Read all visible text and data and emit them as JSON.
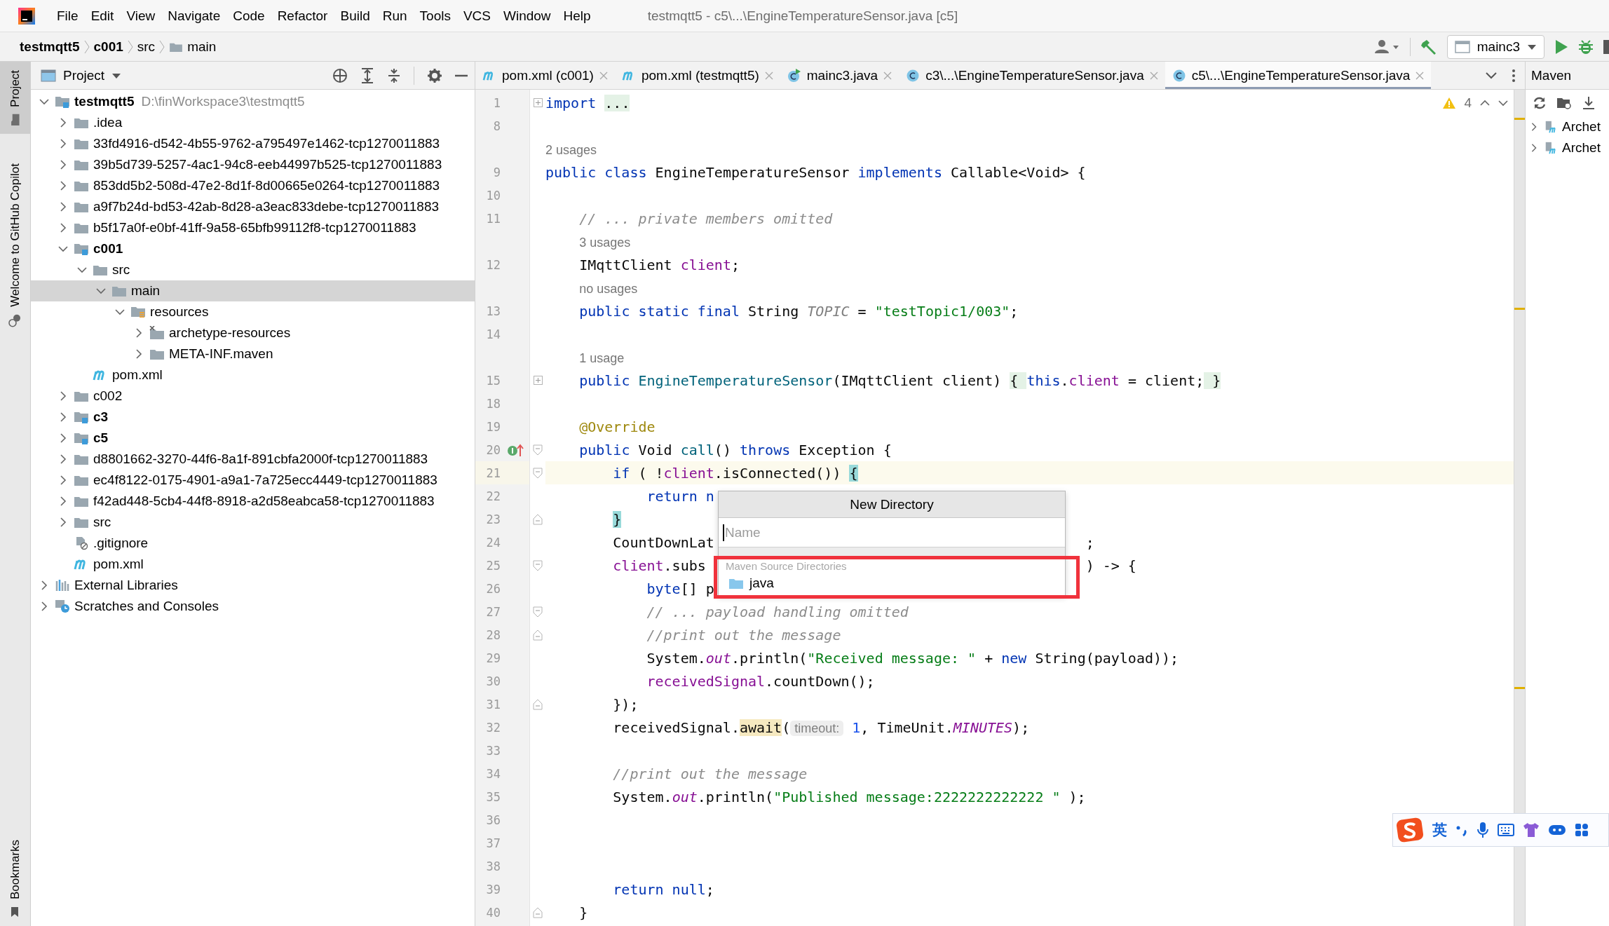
{
  "title_bar": {
    "menu": [
      "File",
      "Edit",
      "View",
      "Navigate",
      "Code",
      "Refactor",
      "Build",
      "Run",
      "Tools",
      "VCS",
      "Window",
      "Help"
    ],
    "title": "testmqtt5 - c5\\...\\EngineTemperatureSensor.java [c5]"
  },
  "breadcrumbs": [
    {
      "label": "testmqtt5",
      "kind": "module"
    },
    {
      "label": "c001",
      "kind": "module"
    },
    {
      "label": "src",
      "kind": "dir"
    },
    {
      "label": "main",
      "kind": "folder"
    }
  ],
  "toolbar": {
    "run_config": "mainc3"
  },
  "side_tabs": [
    {
      "label": "Project",
      "selected": true
    },
    {
      "label": "Welcome to GitHub Copilot",
      "selected": false
    }
  ],
  "side_tabs_bottom": [
    {
      "label": "Bookmarks",
      "selected": false
    }
  ],
  "project": {
    "title": "Project",
    "tree": [
      {
        "label": "testmqtt5",
        "kind": "module",
        "path": "D:\\finWorkspace3\\testmqtt5",
        "expanded": true,
        "selected": false,
        "children": [
          {
            "label": ".idea",
            "kind": "folder",
            "expanded": false,
            "selected": false
          },
          {
            "label": "33fd4916-d542-4b55-9762-a795497e1462-tcp1270011883",
            "kind": "folder",
            "expanded": false,
            "selected": false
          },
          {
            "label": "39b5d739-5257-4ac1-94c8-eeb44997b525-tcp1270011883",
            "kind": "folder",
            "expanded": false,
            "selected": false
          },
          {
            "label": "853dd5b2-508d-47e2-8d1f-8d00665e0264-tcp1270011883",
            "kind": "folder",
            "expanded": false,
            "selected": false
          },
          {
            "label": "a9f7b24d-bd53-42ab-8d28-a3eac833debe-tcp1270011883",
            "kind": "folder",
            "expanded": false,
            "selected": false
          },
          {
            "label": "b5f17a0f-e0bf-41ff-9a58-65bfb99112f8-tcp1270011883",
            "kind": "folder",
            "expanded": false,
            "selected": false
          },
          {
            "label": "c001",
            "kind": "module",
            "expanded": true,
            "selected": false,
            "children": [
              {
                "label": "src",
                "kind": "folder",
                "expanded": true,
                "selected": false,
                "children": [
                  {
                    "label": "main",
                    "kind": "folder",
                    "expanded": true,
                    "selected": true,
                    "children": [
                      {
                        "label": "resources",
                        "kind": "resources",
                        "expanded": true,
                        "selected": false,
                        "children": [
                          {
                            "label": "archetype-resources",
                            "kind": "excluded",
                            "expanded": false,
                            "selected": false
                          },
                          {
                            "label": "META-INF.maven",
                            "kind": "folder",
                            "expanded": false,
                            "selected": false
                          }
                        ]
                      }
                    ]
                  }
                ]
              },
              {
                "label": "pom.xml",
                "kind": "maven",
                "selected": false
              }
            ]
          },
          {
            "label": "c002",
            "kind": "folder",
            "expanded": false,
            "selected": false
          },
          {
            "label": "c3",
            "kind": "module",
            "expanded": false,
            "selected": false
          },
          {
            "label": "c5",
            "kind": "module",
            "expanded": false,
            "selected": false
          },
          {
            "label": "d8801662-3270-44f6-8a1f-891cbfa2000f-tcp1270011883",
            "kind": "folder",
            "expanded": false,
            "selected": false
          },
          {
            "label": "ec4f8122-0175-4901-a9a1-7a725ecc4449-tcp1270011883",
            "kind": "folder",
            "expanded": false,
            "selected": false
          },
          {
            "label": "f42ad448-5cb4-44f8-8918-a2d58eabca58-tcp1270011883",
            "kind": "folder",
            "expanded": false,
            "selected": false
          },
          {
            "label": "src",
            "kind": "folder",
            "expanded": false,
            "selected": false
          },
          {
            "label": ".gitignore",
            "kind": "ignored",
            "selected": false
          },
          {
            "label": "pom.xml",
            "kind": "maven",
            "selected": false
          }
        ]
      },
      {
        "label": "External Libraries",
        "kind": "libraries",
        "expanded": false,
        "selected": false
      },
      {
        "label": "Scratches and Consoles",
        "kind": "scratches",
        "expanded": false,
        "selected": false
      }
    ]
  },
  "editor": {
    "tabs": [
      {
        "label": "pom.xml (c001)",
        "kind": "maven",
        "selected": false
      },
      {
        "label": "pom.xml (testmqtt5)",
        "kind": "maven",
        "selected": false
      },
      {
        "label": "mainc3.java",
        "kind": "runnable",
        "selected": false
      },
      {
        "label": "c3\\...\\EngineTemperatureSensor.java",
        "kind": "class",
        "selected": false
      },
      {
        "label": "c5\\...\\EngineTemperatureSensor.java",
        "kind": "class",
        "selected": true
      }
    ],
    "warnings": "4",
    "lines": [
      {
        "number": "1",
        "current": false,
        "fold": {
          "kind": "collapsed"
        },
        "tokens": [
          {
            "text": "import ",
            "kind": "keyword"
          },
          {
            "text": "...",
            "kind": "folded"
          }
        ]
      },
      {
        "number": "8",
        "current": false
      },
      {
        "tokens": [
          {
            "text": "2 usages",
            "kind": "hint"
          }
        ]
      },
      {
        "number": "9",
        "current": false,
        "tokens": [
          {
            "text": "public class ",
            "kind": "keyword"
          },
          {
            "text": "EngineTemperatureSensor "
          },
          {
            "text": "implements ",
            "kind": "keyword"
          },
          {
            "text": "Callable<Void> {"
          }
        ]
      },
      {
        "number": "10",
        "current": false
      },
      {
        "number": "11",
        "current": false,
        "tokens": [
          {
            "text": "    // ... private members omitted",
            "kind": "comment"
          }
        ]
      },
      {
        "tokens": [
          {
            "text": "    3 usages",
            "kind": "hint"
          }
        ]
      },
      {
        "number": "12",
        "current": false,
        "tokens": [
          {
            "text": "    IMqttClient "
          },
          {
            "text": "client",
            "kind": "field"
          },
          {
            "text": ";"
          }
        ]
      },
      {
        "tokens": [
          {
            "text": "    no usages",
            "kind": "hint"
          }
        ]
      },
      {
        "number": "13",
        "current": false,
        "tokens": [
          {
            "text": "    public static final ",
            "kind": "keyword"
          },
          {
            "text": "String "
          },
          {
            "text": "TOPIC",
            "kind": "constant"
          },
          {
            "text": " = "
          },
          {
            "text": "\"testTopic1/003\"",
            "kind": "string"
          },
          {
            "text": ";"
          }
        ]
      },
      {
        "number": "14",
        "current": false
      },
      {
        "tokens": [
          {
            "text": "    1 usage",
            "kind": "hint"
          }
        ]
      },
      {
        "number": "15",
        "current": false,
        "fold": {
          "kind": "collapsed"
        },
        "tokens": [
          {
            "text": "    public ",
            "kind": "keyword"
          },
          {
            "text": "EngineTemperatureSensor",
            "kind": "method"
          },
          {
            "text": "(IMqttClient client) "
          },
          {
            "text": "{ ",
            "kind": "folded"
          },
          {
            "text": "this",
            "kind": "keyword"
          },
          {
            "text": "."
          },
          {
            "text": "client",
            "kind": "field"
          },
          {
            "text": " = client;"
          },
          {
            "text": " }",
            "kind": "folded"
          }
        ]
      },
      {
        "number": "18",
        "current": false
      },
      {
        "number": "19",
        "current": false,
        "tokens": [
          {
            "text": "    @Override",
            "kind": "annotation"
          }
        ]
      },
      {
        "number": "20",
        "current": false,
        "fold": {
          "kind": "start"
        },
        "marker": {
          "kind": "implements"
        },
        "tokens": [
          {
            "text": "    public ",
            "kind": "keyword"
          },
          {
            "text": "Void "
          },
          {
            "text": "call",
            "kind": "method"
          },
          {
            "text": "() "
          },
          {
            "text": "throws ",
            "kind": "keyword"
          },
          {
            "text": "Exception {"
          }
        ]
      },
      {
        "number": "21",
        "current": true,
        "fold": {
          "kind": "start"
        },
        "tokens": [
          {
            "text": "        if ",
            "kind": "keyword"
          },
          {
            "text": "( !"
          },
          {
            "text": "client",
            "kind": "field"
          },
          {
            "text": ".isConnected()) "
          },
          {
            "text": "{",
            "kind": "brace"
          }
        ]
      },
      {
        "number": "22",
        "current": false,
        "tokens": [
          {
            "text": "            return n",
            "kind": "keyword"
          }
        ]
      },
      {
        "number": "23",
        "current": false,
        "fold": {
          "kind": "end"
        },
        "tokens": [
          {
            "text": "        }",
            "kind": "brace"
          }
        ]
      },
      {
        "number": "24",
        "current": false,
        "tokens": [
          {
            "text": "        CountDownLat"
          }
        ],
        "tokens_after": [
          {
            "text": ";"
          }
        ]
      },
      {
        "number": "25",
        "current": false,
        "fold": {
          "kind": "start"
        },
        "tokens": [
          {
            "text": "        client",
            "kind": "field"
          },
          {
            "text": ".subs"
          }
        ],
        "tokens_after": [
          {
            "text": ") -> {"
          }
        ]
      },
      {
        "number": "26",
        "current": false,
        "tokens": [
          {
            "text": "            byte",
            "kind": "keyword"
          },
          {
            "text": "[] p"
          }
        ]
      },
      {
        "number": "27",
        "current": false,
        "fold": {
          "kind": "start"
        },
        "tokens": [
          {
            "text": "            // ... payload handling omitted",
            "kind": "comment"
          }
        ]
      },
      {
        "number": "28",
        "current": false,
        "fold": {
          "kind": "end"
        },
        "tokens": [
          {
            "text": "            //print out the message",
            "kind": "comment"
          }
        ]
      },
      {
        "number": "29",
        "current": false,
        "tokens": [
          {
            "text": "            System."
          },
          {
            "text": "out",
            "kind": "static"
          },
          {
            "text": ".println("
          },
          {
            "text": "\"Received message: \"",
            "kind": "string"
          },
          {
            "text": " + "
          },
          {
            "text": "new ",
            "kind": "keyword"
          },
          {
            "text": "String(payload));"
          }
        ]
      },
      {
        "number": "30",
        "current": false,
        "tokens": [
          {
            "text": "            receivedSignal",
            "kind": "field"
          },
          {
            "text": ".countDown();"
          }
        ]
      },
      {
        "number": "31",
        "current": false,
        "fold": {
          "kind": "end"
        },
        "tokens": [
          {
            "text": "        });"
          }
        ]
      },
      {
        "number": "32",
        "current": false,
        "tokens": [
          {
            "text": "        receivedSignal."
          },
          {
            "text": "await",
            "kind": "usage"
          },
          {
            "text": "("
          },
          {
            "text": "timeout:",
            "kind": "param"
          },
          {
            "text": " 1",
            "kind": "number"
          },
          {
            "text": ", TimeUnit."
          },
          {
            "text": "MINUTES",
            "kind": "static"
          },
          {
            "text": ");"
          }
        ]
      },
      {
        "number": "33",
        "current": false
      },
      {
        "number": "34",
        "current": false,
        "tokens": [
          {
            "text": "        //print out the message",
            "kind": "comment"
          }
        ]
      },
      {
        "number": "35",
        "current": false,
        "tokens": [
          {
            "text": "        System."
          },
          {
            "text": "out",
            "kind": "static"
          },
          {
            "text": ".println("
          },
          {
            "text": "\"Published message:2222222222222 \"",
            "kind": "string"
          },
          {
            "text": " );"
          }
        ]
      },
      {
        "number": "36",
        "current": false
      },
      {
        "number": "37",
        "current": false
      },
      {
        "number": "38",
        "current": false
      },
      {
        "number": "39",
        "current": false,
        "tokens": [
          {
            "text": "        return null",
            "kind": "keyword"
          },
          {
            "text": ";"
          }
        ]
      },
      {
        "number": "40",
        "current": false,
        "fold": {
          "kind": "end"
        },
        "tokens": [
          {
            "text": "    }"
          }
        ]
      }
    ],
    "popup": {
      "title": "New Directory",
      "placeholder": "Name",
      "section": "Maven Source Directories",
      "items": [
        "java"
      ]
    }
  },
  "maven": {
    "title": "Maven",
    "items": [
      "Archet",
      "Archet"
    ]
  },
  "ime": {
    "mode": "英"
  }
}
